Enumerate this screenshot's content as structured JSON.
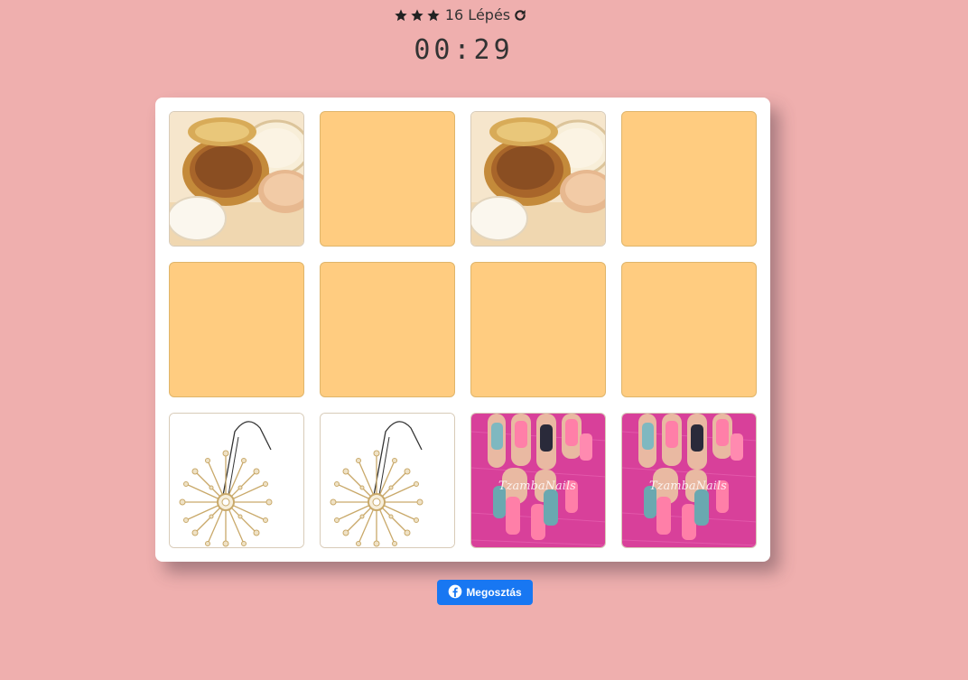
{
  "score": {
    "star_count": 3,
    "moves_label": "16 Lépés",
    "star_icon": "star-icon",
    "restart_icon": "refresh-icon"
  },
  "timer": {
    "value": "00:29"
  },
  "deck": {
    "cards": [
      {
        "state": "open",
        "image": "compact-powder-image"
      },
      {
        "state": "closed"
      },
      {
        "state": "open",
        "image": "compact-powder-image"
      },
      {
        "state": "closed"
      },
      {
        "state": "closed"
      },
      {
        "state": "closed"
      },
      {
        "state": "closed"
      },
      {
        "state": "closed"
      },
      {
        "state": "open",
        "image": "starburst-pendant-image"
      },
      {
        "state": "open",
        "image": "starburst-pendant-image"
      },
      {
        "state": "open",
        "image": "pink-nails-image"
      },
      {
        "state": "open",
        "image": "pink-nails-image"
      }
    ]
  },
  "share": {
    "label": "Megosztás",
    "icon": "facebook-icon"
  },
  "colors": {
    "background": "#efafae",
    "card_back": "#ffcc80",
    "share_button": "#1877f2"
  }
}
